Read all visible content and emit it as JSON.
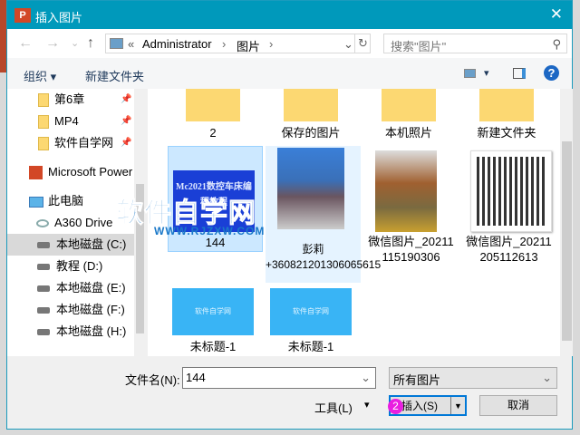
{
  "window": {
    "title": "插入图片",
    "close": "✕",
    "app_icon": "P"
  },
  "nav": {
    "back": "←",
    "forward": "→",
    "recent": "⌄",
    "up": "↑"
  },
  "address": {
    "sep": "«",
    "crumbs": [
      "Administrator",
      "图片"
    ],
    "chev": "›",
    "dropdown": "⌄",
    "refresh": "↻"
  },
  "search": {
    "placeholder": "搜索\"图片\"",
    "icon": "⚲"
  },
  "toolbar": {
    "organize": "组织 ▾",
    "new_folder": "新建文件夹",
    "view": "▾",
    "help": "?"
  },
  "sidebar": {
    "items": [
      {
        "label": "第6章",
        "type": "folder",
        "pinned": true
      },
      {
        "label": "MP4",
        "type": "folder",
        "pinned": true
      },
      {
        "label": "软件自学网",
        "type": "folder",
        "pinned": true
      },
      {
        "label": "Microsoft Power",
        "type": "app"
      },
      {
        "label": "此电脑",
        "type": "pc"
      },
      {
        "label": "A360 Drive",
        "type": "cloud"
      },
      {
        "label": "本地磁盘 (C:)",
        "type": "drive",
        "selected": true
      },
      {
        "label": "教程 (D:)",
        "type": "drive"
      },
      {
        "label": "本地磁盘 (E:)",
        "type": "drive"
      },
      {
        "label": "本地磁盘 (F:)",
        "type": "drive"
      },
      {
        "label": "本地磁盘 (H:)",
        "type": "drive"
      }
    ]
  },
  "files": [
    {
      "name": "2",
      "kind": "folder"
    },
    {
      "name": "保存的图片",
      "kind": "folder"
    },
    {
      "name": "本机照片",
      "kind": "folder"
    },
    {
      "name": "新建文件夹",
      "kind": "folder"
    },
    {
      "name": "144",
      "kind": "image",
      "selected": true,
      "thumb_text": "Mc2021数控车床编程教程"
    },
    {
      "name": "彭莉 +360821201306065615",
      "kind": "image"
    },
    {
      "name": "微信图片_20211115190306",
      "kind": "image"
    },
    {
      "name": "微信图片_20211205112613",
      "kind": "image"
    },
    {
      "name": "未标题-1",
      "kind": "image",
      "thumb_text": "软件自学网"
    },
    {
      "name": "未标题-1",
      "kind": "image",
      "thumb_text": "软件自学网"
    }
  ],
  "footer": {
    "filename_label": "文件名(N):",
    "filename_value": "144",
    "filter": "所有图片",
    "tools": "工具(L)",
    "tools_arrow": "▾",
    "insert": "插入(S)",
    "insert_arrow": "▼",
    "cancel": "取消"
  },
  "annotation": {
    "step": "2"
  },
  "watermark": {
    "text": "软件自学网",
    "url": "WWW.RJZXW.COM"
  }
}
